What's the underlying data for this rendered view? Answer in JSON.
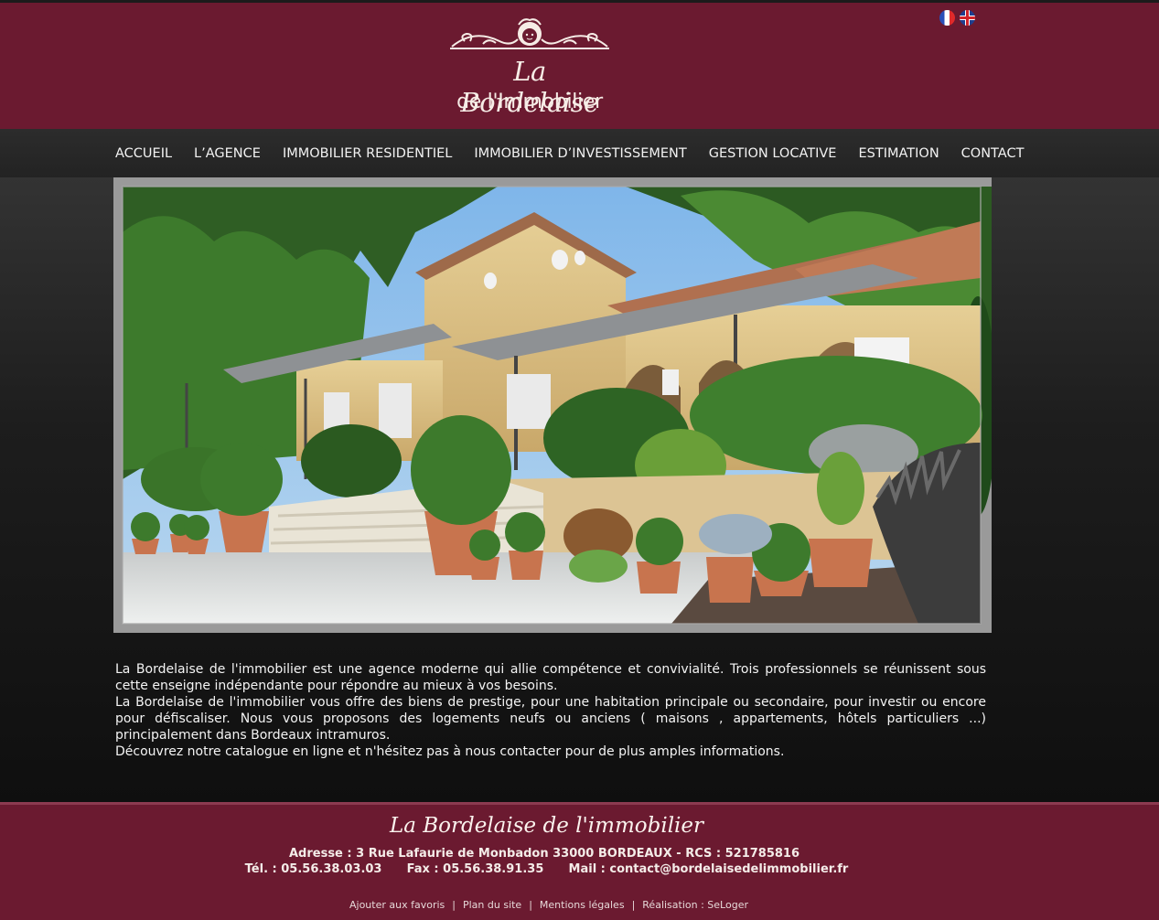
{
  "header": {
    "logo_line1": "La Bordelaise",
    "logo_line2": "de l'Immobilier",
    "languages": [
      "Français",
      "English"
    ]
  },
  "nav": {
    "items": [
      {
        "label": "ACCUEIL"
      },
      {
        "label": "L’AGENCE"
      },
      {
        "label": "IMMOBILIER RESIDENTIEL"
      },
      {
        "label": "IMMOBILIER D’INVESTISSEMENT"
      },
      {
        "label": "GESTION LOCATIVE"
      },
      {
        "label": "ESTIMATION"
      },
      {
        "label": "CONTACT"
      }
    ]
  },
  "intro": {
    "p1": "La Bordelaise de l'immobilier est une agence moderne qui allie compétence et convivialité. Trois professionnels se réunissent sous cette enseigne indépendante pour répondre au mieux à vos besoins.",
    "p2": "La Bordelaise de l'immobilier vous offre des biens de prestige, pour une habitation principale ou secondaire, pour investir ou encore pour défiscaliser. Nous vous proposons des logements neufs ou anciens ( maisons , appartements, hôtels particuliers ...) principalement dans Bordeaux intramuros.",
    "p3": "Découvrez notre catalogue en ligne et n'hésitez pas à nous contacter pour de plus amples informations."
  },
  "footer": {
    "title": "La Bordelaise de l'immobilier",
    "address": "Adresse : 3 Rue Lafaurie de Monbadon 33000 BORDEAUX - RCS : 521785816",
    "tel": "Tél. : 05.56.38.03.03",
    "fax": "Fax : 05.56.38.91.35",
    "mail": "Mail : contact@bordelaisedelimmobilier.fr",
    "links": {
      "favoris": "Ajouter aux favoris",
      "plan": "Plan du site",
      "mentions": "Mentions légales",
      "realisation": "Réalisation : SeLoger"
    }
  },
  "colors": {
    "brand": "#6b1a30",
    "navbar": "#262626",
    "text_light": "#f4f4f4"
  }
}
